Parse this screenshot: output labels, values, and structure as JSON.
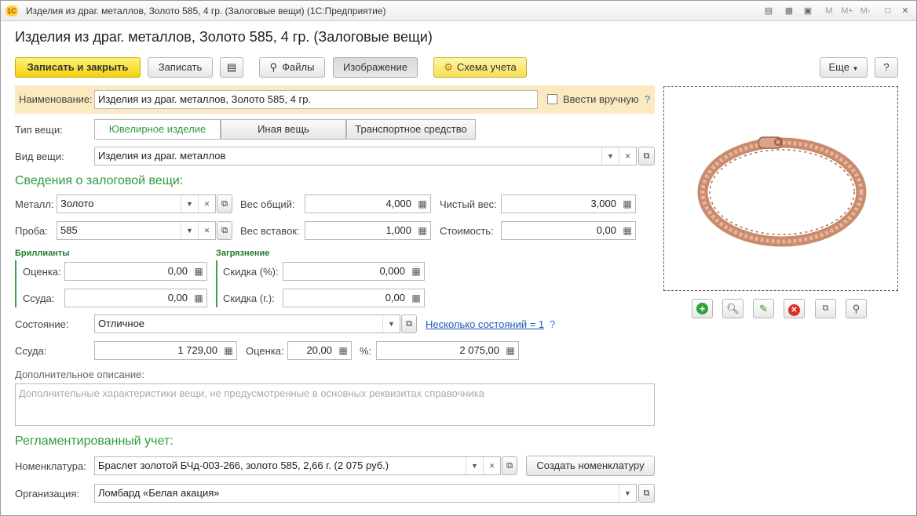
{
  "window": {
    "title": "Изделия из драг. металлов, Золото 585, 4 гр. (Залоговые вещи)  (1С:Предприятие)",
    "logo": "1С",
    "controls": [
      "M",
      "M+",
      "M-"
    ]
  },
  "form": {
    "title": "Изделия из драг. металлов, Золото 585, 4 гр. (Залоговые вещи)"
  },
  "toolbar": {
    "save_close": "Записать и закрыть",
    "save": "Записать",
    "files": "Файлы",
    "image": "Изображение",
    "scheme": "Схема учета",
    "more": "Еще",
    "help": "?"
  },
  "name": {
    "label": "Наименование:",
    "value": "Изделия из драг. металлов, Золото 585, 4 гр.",
    "manual_label": "Ввести вручную",
    "help": "?"
  },
  "item_type": {
    "label": "Тип вещи:",
    "options": [
      "Ювелирное изделие",
      "Иная вещь",
      "Транспортное средство"
    ],
    "selected": 0
  },
  "item_kind": {
    "label": "Вид вещи:",
    "value": "Изделия из драг. металлов"
  },
  "pledge": {
    "header": "Сведения о залоговой вещи:",
    "metal_label": "Металл:",
    "metal": "Золото",
    "probe_label": "Проба:",
    "probe": "585",
    "weight_total_label": "Вес общий:",
    "weight_total": "4,000",
    "weight_inserts_label": "Вес вставок:",
    "weight_inserts": "1,000",
    "net_weight_label": "Чистый вес:",
    "net_weight": "3,000",
    "cost_label": "Стоимость:",
    "cost": "0,00"
  },
  "diamonds": {
    "header": "Бриллианты",
    "estimate_label": "Оценка:",
    "estimate": "0,00",
    "loan_label": "Ссуда:",
    "loan": "0,00"
  },
  "dirt": {
    "header": "Загрязнение",
    "discount_pct_label": "Скидка (%):",
    "discount_pct": "0,000",
    "discount_g_label": "Скидка (г.):",
    "discount_g": "0,00"
  },
  "condition": {
    "label": "Состояние:",
    "value": "Отличное",
    "link": "Несколько состояний = 1",
    "help": "?"
  },
  "loan_row": {
    "loan_label": "Ссуда:",
    "loan": "1 729,00",
    "estimate_label": "Оценка:",
    "estimate": "20,00",
    "pct_label": "%:",
    "pct_value": "2 075,00"
  },
  "description": {
    "label": "Дополнительное описание:",
    "placeholder": "Дополнительные характеристики вещи, не предусмотренные в основных реквизитах справочника"
  },
  "accounting": {
    "header": "Регламентированный учет:",
    "nomenclature_label": "Номенклатура:",
    "nomenclature": "Браслет золотой БЧд-003-266, золото 585, 2,66 г. (2 075 руб.)",
    "create_button": "Создать номенклатуру",
    "org_label": "Организация:",
    "org": "Ломбард «Белая акация»"
  },
  "image_panel": {
    "buttons": [
      "add-icon",
      "view-icon",
      "edit-icon",
      "delete-icon",
      "open-icon",
      "attach-icon"
    ]
  },
  "colors": {
    "accent_yellow": "#f3d20c",
    "green_header": "#2e9b3e",
    "name_bar": "#fbe9bf",
    "link": "#1b5ab8"
  }
}
